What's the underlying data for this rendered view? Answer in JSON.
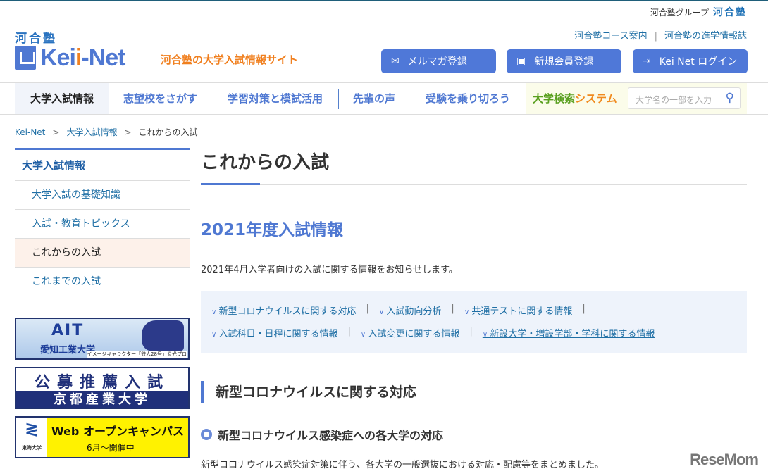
{
  "topbar": {
    "group_label": "河合塾グループ",
    "group_logo": "河合塾"
  },
  "header": {
    "logo_kawai": "河合塾",
    "logo_kei": "Kei",
    "logo_i": "i",
    "logo_net": "-Net",
    "tagline": "河合塾の大学入試情報サイト",
    "links": [
      "河合塾コース案内",
      "河合塾の進学情報誌"
    ],
    "buttons": [
      {
        "label": "メルマガ登録",
        "icon": "mail-icon"
      },
      {
        "label": "新規会員登録",
        "icon": "user-icon"
      },
      {
        "label": "Kei Net ログイン",
        "icon": "login-icon"
      }
    ]
  },
  "nav": {
    "items": [
      "大学入試情報",
      "志望校をさがす",
      "学習対策と模試活用",
      "先輩の声",
      "受験を乗り切ろう"
    ],
    "search_label_a": "大学検索",
    "search_label_b": "システム",
    "search_placeholder": "大学名の一部を入力"
  },
  "breadcrumb": [
    "Kei-Net",
    "大学入試情報",
    "これからの入試"
  ],
  "sidebar": {
    "heading": "大学入試情報",
    "items": [
      "大学入試の基礎知識",
      "入試・教育トピックス",
      "これからの入試",
      "これまでの入試"
    ]
  },
  "banners": {
    "ait": {
      "title": "AIT",
      "name": "愛知工業大学",
      "credit": "イメージキャラクター「鉄人28号」©光プロ"
    },
    "kyoto": {
      "title": "公募推薦入試",
      "name": "京都産業大学"
    },
    "tokai": {
      "logo": "東海大学",
      "title": "Web オープンキャンパス",
      "sub": "6月〜開催中"
    }
  },
  "main": {
    "title": "これからの入試",
    "section_title": "2021年度入試情報",
    "intro": "2021年4月入学者向けの入試に関する情報をお知らせします。",
    "anchors_row1": [
      "新型コロナウイルスに関する対応",
      "入試動向分析",
      "共通テストに関する情報"
    ],
    "anchors_row2": [
      "入試科目・日程に関する情報",
      "入試変更に関する情報",
      "新設大学・増設学部・学科に関する情報"
    ],
    "h3": "新型コロナウイルスに関する対応",
    "h4": "新型コロナウイルス感染症への各大学の対応",
    "body": "新型コロナウイルス感染症対策に伴う、各大学の一般選抜における対応・配慮等をまとめました。"
  },
  "watermark": "ReseMom"
}
